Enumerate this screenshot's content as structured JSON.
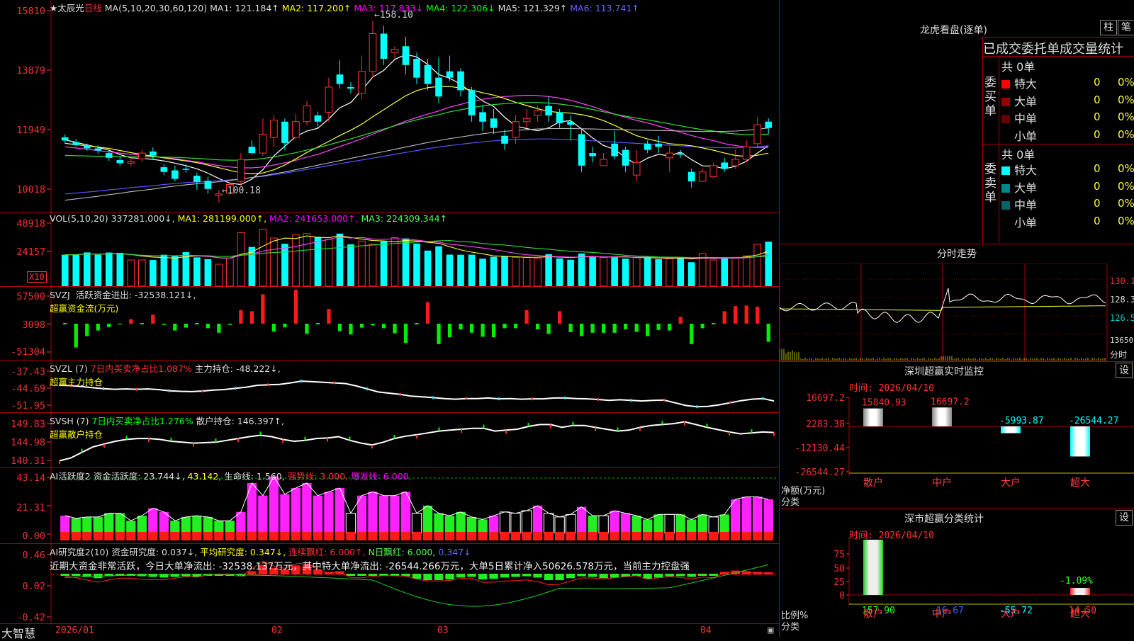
{
  "stock": {
    "star": "★",
    "name": "太辰光",
    "period": "日线",
    "ma_params": "MA(5,10,20,30,60,120)",
    "ma1": "MA1: 121.184↑",
    "ma2": "MA2: 117.200↑",
    "ma3": "MA3: 117.833↓",
    "ma4": "MA4: 122.306↓",
    "ma5": "MA5: 121.329↑",
    "ma6": "MA6: 113.741↑",
    "high_mark": "158.10",
    "low_mark": "100.18"
  },
  "price_axis": [
    "15810",
    "13879",
    "11949",
    "10018"
  ],
  "vol": {
    "params": "VOL(5,10,20)",
    "value": "337281.000↓,",
    "ma1": "MA1: 281199.000↑,",
    "ma2": "MA2: 241653.000↑,",
    "ma3": "MA3: 224309.344↑",
    "axis": [
      "48918",
      "24157"
    ],
    "unit": "X10"
  },
  "svzj": {
    "name": "SVZJ",
    "line1": "活跃资金进出: -32538.121↓,",
    "line2": "超赢资金流(万元)",
    "axis": [
      "57500",
      "3098",
      "-51304"
    ]
  },
  "svzl": {
    "name": "SVZL (7)",
    "pct": "7日内买卖净占比1.087%",
    "hold": "主力持仓: -48.222↓,",
    "line2": "超赢主力持仓",
    "axis": [
      "-37.43",
      "-44.69",
      "-51.95"
    ]
  },
  "svsh": {
    "name": "SVSH (7)",
    "pct": "7日内买卖净占比1.276%",
    "hold": "散户持仓: 146.397↑,",
    "line2": "超赢散户持仓",
    "axis": [
      "149.83",
      "144.98",
      "140.31"
    ]
  },
  "ai_active": {
    "name": "AI活跃度2",
    "a": "资金活跃度: 23.744↓,",
    "b": "43.142,",
    "c": "生命线: 1.560,",
    "d": "强势线: 3.000,",
    "e": "爆发线: 6.000,",
    "axis": [
      "43.14",
      "21.31",
      "0.00"
    ]
  },
  "ai_research": {
    "name": "AI研究度2(10)",
    "a": "资金研究度: 0.037↓,",
    "b": "平均研究度: 0.347↓,",
    "c": "连续飘红: 6.000↑,",
    "d": "N日飘红: 6.000,",
    "e": "0.347↓",
    "comment": "近期大资金非常活跃，今日大单净流出: -32538.137万元，其中特大单净流出: -26544.266万元，大单5日累计净入50626.578万元，当前主力控盘强",
    "axis": [
      "0.46",
      "0.02",
      "-0.42"
    ]
  },
  "date_axis": [
    "2026/01",
    "02",
    "03",
    "04"
  ],
  "brand": "大智慧",
  "longhu": {
    "title": "龙虎看盘(逐单)",
    "btn_zhu": "柱",
    "btn_bi": "笔",
    "subtitle": "已成交委托单成交量统计",
    "buy_label": "委买单",
    "sell_label": "委卖单",
    "buy_total": "共 0单",
    "sell_total": "共 0单",
    "buy_rows": [
      {
        "name": "特大",
        "count": "0",
        "pct": "0%",
        "color": "#ff0000"
      },
      {
        "name": "大单",
        "count": "0",
        "pct": "0%",
        "color": "#990000"
      },
      {
        "name": "中单",
        "count": "0",
        "pct": "0%",
        "color": "#660000"
      },
      {
        "name": "小单",
        "count": "0",
        "pct": "0%",
        "color": ""
      }
    ],
    "sell_rows": [
      {
        "name": "特大",
        "count": "0",
        "pct": "0%",
        "color": "#00ffff"
      },
      {
        "name": "大单",
        "count": "0",
        "pct": "0%",
        "color": "#008888"
      },
      {
        "name": "中单",
        "count": "0",
        "pct": "0%",
        "color": "#006666"
      },
      {
        "name": "小单",
        "count": "0",
        "pct": "0%",
        "color": ""
      }
    ]
  },
  "fenshi": {
    "title": "分时走势",
    "axis": [
      "130.1",
      "128.3",
      "126.5",
      "13650",
      "分时"
    ]
  },
  "monitor": {
    "title": "深圳超赢实时监控",
    "btn": "设",
    "time": "时间: 2026/04/10",
    "axis": [
      "16697.2",
      "2283.38",
      "-12130.44",
      "-26544.27"
    ],
    "unit": "净额(万元)",
    "cat_label": "分类",
    "bars": [
      {
        "label": "散户",
        "value": 15840.93,
        "text": "15840.93"
      },
      {
        "label": "中户",
        "value": 16697.2,
        "text": "16697.2"
      },
      {
        "label": "大户",
        "value": -5993.87,
        "text": "-5993.87"
      },
      {
        "label": "超大",
        "value": -26544.27,
        "text": "-26544.27"
      }
    ]
  },
  "classify": {
    "title": "深市超赢分类统计",
    "btn": "设",
    "time": "时间: 2026/04/10",
    "axis": [
      "75",
      "50",
      "25",
      "0"
    ],
    "unit": "比例%",
    "cat_label": "分类",
    "extra": "-1.09%",
    "bars": [
      {
        "label": "散户",
        "value": 157.9,
        "text": "157.90"
      },
      {
        "label": "中户",
        "value": -16.67,
        "text": "-16.67"
      },
      {
        "label": "大户",
        "value": -55.72,
        "text": "-55.72"
      },
      {
        "label": "超大",
        "value": 14.5,
        "text": "14.50"
      }
    ]
  },
  "chart_data": {
    "type": "candlestick",
    "title": "太辰光 日线",
    "ylim": [
      10018,
      15810
    ],
    "candles": [
      [
        121.0,
        120.0,
        122.0,
        119.0
      ],
      [
        119.5,
        118.5,
        120.5,
        118.0
      ],
      [
        118.5,
        117.5,
        119.0,
        116.8
      ],
      [
        117.5,
        116.8,
        118.5,
        115.8
      ],
      [
        116.0,
        114.5,
        117.0,
        113.5
      ],
      [
        113.8,
        112.8,
        114.8,
        112.0
      ],
      [
        112.8,
        113.2,
        114.8,
        111.8
      ],
      [
        114.2,
        116.0,
        117.0,
        113.2
      ],
      [
        116.5,
        115.2,
        117.8,
        114.0
      ],
      [
        111.5,
        110.0,
        112.5,
        109.0
      ],
      [
        110.5,
        107.8,
        112.0,
        107.0
      ],
      [
        111.0,
        110.8,
        112.4,
        109.8
      ],
      [
        108.8,
        106.8,
        109.8,
        104.3
      ],
      [
        107.2,
        104.6,
        108.5,
        103.0
      ],
      [
        102.6,
        103.0,
        104.3,
        100.2
      ],
      [
        103.2,
        106.0,
        107.0,
        102.5
      ],
      [
        107.0,
        114.0,
        116.0,
        105.5
      ],
      [
        118.0,
        116.0,
        120.0,
        115.5
      ],
      [
        116.0,
        122.0,
        127.0,
        115.0
      ],
      [
        121.0,
        126.5,
        128.0,
        118.0
      ],
      [
        126.0,
        119.2,
        127.0,
        117.0
      ],
      [
        121.0,
        126.0,
        128.5,
        120.5
      ],
      [
        126.0,
        131.0,
        132.5,
        125.0
      ],
      [
        128.0,
        126.0,
        129.2,
        124.0
      ],
      [
        129.0,
        137.0,
        140.0,
        126.0
      ],
      [
        141.0,
        138.0,
        145.5,
        136.5
      ],
      [
        137.0,
        136.5,
        138.5,
        135.0
      ],
      [
        135.0,
        142.0,
        147.0,
        133.0
      ],
      [
        142.0,
        154.0,
        158.1,
        140.0
      ],
      [
        154.0,
        146.0,
        156.5,
        144.0
      ],
      [
        148.0,
        149.0,
        150.0,
        146.0
      ],
      [
        150.0,
        144.0,
        153.0,
        141.0
      ],
      [
        146.0,
        140.0,
        148.0,
        138.0
      ],
      [
        144.0,
        138.0,
        146.0,
        136.0
      ],
      [
        140.0,
        134.0,
        146.5,
        132.0
      ],
      [
        142.0,
        140.0,
        147.0,
        139.0
      ],
      [
        142.0,
        136.0,
        143.0,
        134.0
      ],
      [
        136.0,
        128.0,
        137.0,
        126.0
      ],
      [
        129.0,
        126.0,
        131.0,
        123.0
      ],
      [
        127.0,
        124.0,
        130.0,
        122.0
      ],
      [
        121.5,
        119.0,
        123.5,
        117.0
      ],
      [
        121.0,
        126.0,
        128.0,
        119.0
      ],
      [
        126.0,
        127.0,
        130.0,
        124.0
      ],
      [
        128.0,
        129.5,
        131.0,
        126.0
      ],
      [
        131.0,
        128.0,
        134.0,
        126.0
      ],
      [
        129.0,
        125.5,
        130.0,
        124.0
      ],
      [
        126.0,
        125.0,
        128.0,
        120.0
      ],
      [
        122.0,
        112.0,
        124.0,
        110.0
      ],
      [
        116.0,
        115.0,
        118.0,
        113.0
      ],
      [
        112.0,
        114.0,
        116.0,
        112.0
      ],
      [
        119.0,
        115.0,
        123.0,
        114.0
      ],
      [
        117.0,
        112.0,
        118.0,
        110.0
      ],
      [
        109.0,
        113.0,
        117.0,
        107.0
      ],
      [
        119.0,
        117.0,
        120.0,
        116.0
      ],
      [
        119.0,
        118.0,
        121.5,
        116.0
      ],
      [
        114.5,
        116.0,
        118.0,
        110.0
      ],
      [
        116.0,
        115.5,
        117.0,
        114.5
      ],
      [
        110.0,
        107.0,
        111.0,
        105.0
      ],
      [
        107.0,
        110.0,
        111.0,
        107.0
      ],
      [
        108.5,
        112.0,
        113.0,
        108.0
      ],
      [
        113.0,
        111.0,
        114.5,
        110.0
      ],
      [
        112.0,
        114.0,
        117.0,
        111.0
      ],
      [
        114.0,
        118.0,
        120.0,
        113.0
      ],
      [
        119.0,
        125.0,
        127.5,
        118.0
      ],
      [
        126.0,
        124.0,
        127.0,
        122.0
      ]
    ],
    "ma_values": {
      "MA5": [
        120.2,
        119.4,
        118.6,
        117.8,
        116.9,
        115.5,
        114.5,
        114.3,
        114.0,
        113.5,
        112.8,
        112.0,
        111.0,
        109.6,
        107.9,
        106.4,
        106.0,
        107.7,
        110.7,
        115.1,
        118.2,
        121.3,
        123.0,
        123.9,
        126.9,
        130.4,
        132.1,
        136.0,
        140.2,
        142.3,
        145.8,
        147.4,
        146.6,
        144.2,
        141.0,
        139.8,
        137.9,
        135.2,
        132.6,
        130.8,
        127.4,
        124.6,
        123.8,
        123.1,
        124.0,
        126.0,
        126.3,
        123.7,
        120.8,
        118.4,
        117.2,
        114.5,
        112.4,
        114.4,
        115.6,
        115.1,
        116.3,
        113.9,
        111.9,
        111.9,
        111.0,
        111.8,
        113.4,
        116.0,
        118.4
      ],
      "MA20": [
        118.0,
        117.6,
        117.2,
        116.8,
        116.4,
        116.0,
        115.6,
        115.3,
        115.0,
        114.6,
        114.2,
        113.7,
        113.2,
        112.6,
        112.0,
        111.6,
        111.3,
        111.3,
        111.6,
        112.2,
        112.9,
        113.7,
        114.7,
        115.6,
        116.8,
        118.1,
        119.3,
        120.6,
        122.0,
        123.4,
        124.8,
        126.2,
        127.3,
        128.4,
        129.4,
        130.6,
        131.5,
        132.4,
        133.1,
        133.6,
        134.0,
        134.2,
        134.4,
        134.3,
        134.0,
        133.5,
        132.8,
        131.8,
        130.8,
        129.6,
        128.4,
        127.4,
        126.4,
        125.6,
        124.6,
        123.6,
        122.6,
        121.6,
        120.7,
        120.0,
        119.0,
        118.4,
        117.9,
        117.8,
        117.8
      ],
      "MA60": [
        103.0,
        103.3,
        103.6,
        103.9,
        104.3,
        104.6,
        105.0,
        105.3,
        105.6,
        106.0,
        106.3,
        106.6,
        106.8,
        107.0,
        107.2,
        107.5,
        107.8,
        108.2,
        108.6,
        109.1,
        109.6,
        110.2,
        110.8,
        111.4,
        112.0,
        112.6,
        113.2,
        113.8,
        114.4,
        115.0,
        115.6,
        116.2,
        116.8,
        117.4,
        117.9,
        118.4,
        118.8,
        119.2,
        119.6,
        119.9,
        120.1,
        120.3,
        120.4,
        120.5,
        120.5,
        120.4,
        120.3,
        120.1,
        119.9,
        119.7,
        119.5,
        119.3,
        119.1,
        118.9,
        118.7,
        118.5,
        118.3,
        118.1,
        117.9,
        117.8,
        117.7,
        117.7,
        117.8,
        118.0,
        118.3
      ]
    },
    "volume": [
      24000,
      24100,
      25800,
      24000,
      25700,
      25500,
      20000,
      20000,
      20000,
      24000,
      23000,
      26000,
      22000,
      20600,
      16800,
      21500,
      41000,
      30000,
      43500,
      36800,
      32400,
      39200,
      40200,
      37700,
      35700,
      40200,
      32000,
      34500,
      32000,
      34200,
      37100,
      36500,
      32600,
      27200,
      30500,
      24100,
      24000,
      24100,
      21000,
      22400,
      22800,
      22000,
      22000,
      21400,
      24400,
      21200,
      20200,
      25000,
      22700,
      22000,
      22000,
      21000,
      21800,
      22000,
      20600,
      21000,
      22000,
      18300,
      24900,
      20000,
      22000,
      22000,
      23200,
      32000,
      34000
    ],
    "svzj": [
      0,
      -21000,
      -11000,
      -6000,
      -3000,
      -800,
      4000,
      0,
      8000,
      -1000,
      -6000,
      -3500,
      0,
      -4000,
      -8000,
      -1000,
      12000,
      11000,
      26000,
      -7000,
      -3200,
      30000,
      -9000,
      0,
      13000,
      -6500,
      -9500,
      -3500,
      -1500,
      -4000,
      -8500,
      -17000,
      0,
      19000,
      -18000,
      -12000,
      -5000,
      -8000,
      -11500,
      -12000,
      -4000,
      -4000,
      12000,
      -5000,
      -9000,
      11000,
      -7500,
      -11000,
      -8000,
      -8000,
      -8000,
      -5000,
      -7200,
      -11000,
      -5500,
      -6000,
      6000,
      -18000,
      -4000,
      0,
      11000,
      15500,
      16000,
      15000,
      -16000
    ],
    "ai_active": [
      [
        14,
        "m"
      ],
      [
        12,
        "G"
      ],
      [
        13,
        "G"
      ],
      [
        13,
        "G"
      ],
      [
        16,
        "G"
      ],
      [
        16,
        "G"
      ],
      [
        10,
        "G"
      ],
      [
        14,
        "G"
      ],
      [
        20,
        "m"
      ],
      [
        17,
        "m"
      ],
      [
        10,
        "G"
      ],
      [
        13,
        "G"
      ],
      [
        14,
        "G"
      ],
      [
        13,
        "G"
      ],
      [
        10,
        "G"
      ],
      [
        10,
        "G"
      ],
      [
        17,
        "m"
      ],
      [
        40,
        "m"
      ],
      [
        30,
        "m"
      ],
      [
        45,
        "m"
      ],
      [
        31,
        "m"
      ],
      [
        36,
        "m"
      ],
      [
        40,
        "m"
      ],
      [
        30,
        "m"
      ],
      [
        33,
        "m"
      ],
      [
        36,
        "m"
      ],
      [
        16,
        "h"
      ],
      [
        30,
        "m"
      ],
      [
        33,
        "m"
      ],
      [
        30,
        "m"
      ],
      [
        30,
        "m"
      ],
      [
        33,
        "m"
      ],
      [
        16,
        "h"
      ],
      [
        22,
        "G"
      ],
      [
        16,
        "G"
      ],
      [
        14,
        "G"
      ],
      [
        17,
        "G"
      ],
      [
        13,
        "G"
      ],
      [
        11,
        "G"
      ],
      [
        14,
        "m"
      ],
      [
        17,
        "h"
      ],
      [
        16,
        "h"
      ],
      [
        18,
        "h"
      ],
      [
        22,
        "m"
      ],
      [
        16,
        "h"
      ],
      [
        13,
        "h"
      ],
      [
        15,
        "h"
      ],
      [
        21,
        "m"
      ],
      [
        14,
        "G"
      ],
      [
        14,
        "h"
      ],
      [
        18,
        "m"
      ],
      [
        16,
        "m"
      ],
      [
        14,
        "G"
      ],
      [
        11,
        "G"
      ],
      [
        15,
        "G"
      ],
      [
        15,
        "h"
      ],
      [
        15,
        "G"
      ],
      [
        11,
        "G"
      ],
      [
        15,
        "G"
      ],
      [
        13,
        "h"
      ],
      [
        15,
        "G"
      ],
      [
        27,
        "m"
      ],
      [
        29,
        "m"
      ],
      [
        29,
        "m"
      ],
      [
        27,
        "m"
      ]
    ],
    "ai_research_bars": [
      -0.02,
      -0.03,
      -0.05,
      -0.07,
      -0.04,
      -0.02,
      -0.02,
      -0.04,
      -0.05,
      -0.06,
      -0.05,
      -0.04,
      -0.05,
      -0.03,
      -0.02,
      -0.02,
      -0.04,
      0.05,
      0.15,
      0.1,
      0.08,
      0.14,
      0.16,
      0.08,
      0.04,
      0.05,
      -0.02,
      -0.03,
      -0.02,
      -0.02,
      -0.03,
      -0.04,
      -0.08,
      -0.1,
      -0.1,
      -0.09,
      -0.06,
      -0.05,
      -0.09,
      -0.08,
      -0.06,
      -0.05,
      -0.04,
      -0.06,
      -0.1,
      -0.1,
      -0.07,
      -0.04,
      -0.05,
      -0.07,
      -0.06,
      -0.05,
      -0.04,
      -0.08,
      -0.06,
      -0.04,
      -0.04,
      -0.05,
      -0.02,
      -0.02,
      0.04,
      0.06,
      0.05,
      0.04,
      0.03
    ],
    "svzl_line": [
      -43.8,
      -43.9,
      -44.2,
      -44.6,
      -44.9,
      -45.1,
      -45.0,
      -45.1,
      -45.0,
      -45.2,
      -45.6,
      -45.8,
      -45.9,
      -45.7,
      -45.4,
      -45.2,
      -44.8,
      -44.4,
      -43.8,
      -43.6,
      -43.5,
      -43.0,
      -42.4,
      -42.6,
      -42.8,
      -43.0,
      -43.2,
      -44.0,
      -45.0,
      -46.0,
      -46.4,
      -46.8,
      -47.4,
      -47.6,
      -47.9,
      -48.2,
      -48.4,
      -48.2,
      -48.2,
      -48.0,
      -48.3,
      -48.2,
      -48.4,
      -48.3,
      -48.3,
      -48.0,
      -48.0,
      -48.2,
      -48.3,
      -48.5,
      -48.8,
      -48.6,
      -48.8,
      -49.0,
      -48.8,
      -48.7,
      -49.6,
      -50.5,
      -50.9,
      -50.8,
      -50.3,
      -49.6,
      -48.9,
      -48.4,
      -48.2,
      -49.0
    ],
    "svsh_line": [
      140.8,
      141.4,
      142.6,
      143.8,
      144.4,
      145.0,
      145.4,
      145.6,
      145.6,
      145.4,
      145.0,
      144.8,
      144.6,
      144.7,
      144.8,
      145.2,
      145.6,
      146.0,
      146.3,
      146.0,
      145.4,
      145.0,
      145.2,
      145.6,
      145.7,
      146.0,
      145.2,
      144.6,
      144.2,
      144.8,
      145.6,
      146.1,
      146.4,
      146.8,
      147.2,
      147.4,
      147.6,
      147.8,
      147.8,
      147.2,
      147.4,
      147.6,
      148.2,
      148.6,
      148.6,
      148.0,
      148.4,
      148.4,
      148.0,
      147.6,
      147.2,
      147.4,
      148.0,
      148.4,
      148.6,
      148.8,
      149.2,
      148.6,
      148.0,
      147.5,
      147.0,
      146.6,
      146.8,
      147.0,
      146.9
    ]
  }
}
